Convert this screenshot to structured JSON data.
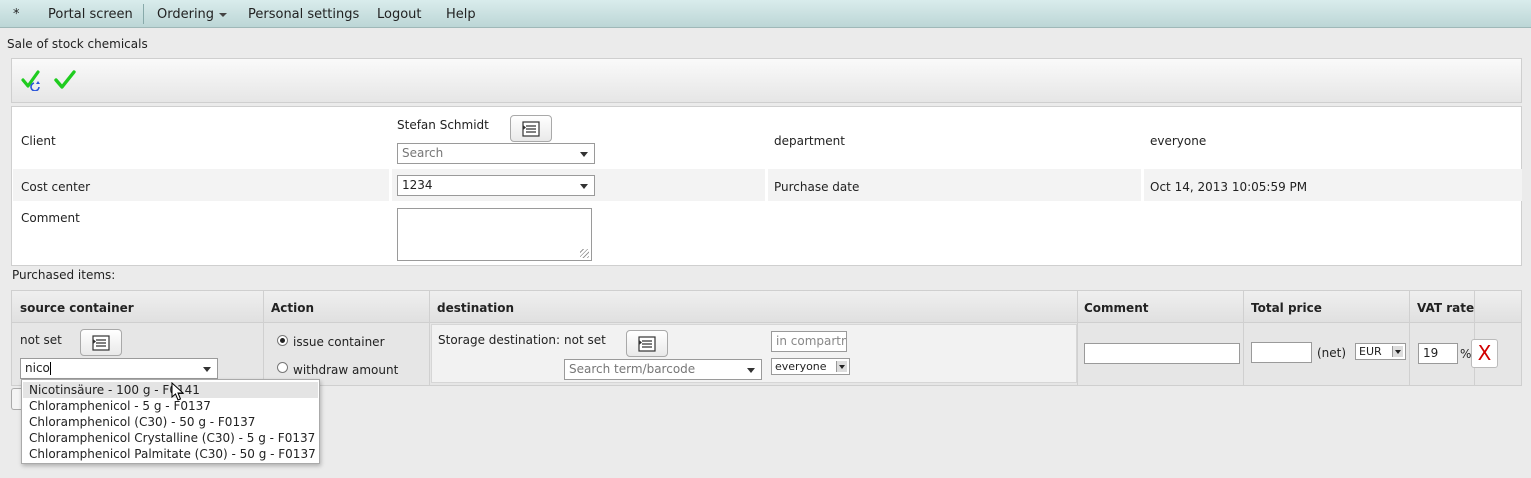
{
  "menu": {
    "star": "*",
    "portal": "Portal screen",
    "ordering": "Ordering",
    "personal_settings": "Personal settings",
    "logout": "Logout",
    "help": "Help"
  },
  "page_title": "Sale of stock chemicals",
  "toolbar": {
    "icons": [
      "check-refresh-icon",
      "check-icon"
    ],
    "accent": "#1fcc1f"
  },
  "form": {
    "client_label": "Client",
    "client_name": "Stefan Schmidt",
    "client_search_placeholder": "Search",
    "department_label": "department",
    "department_value": "everyone",
    "cost_center_label": "Cost center",
    "cost_center_value": "1234",
    "purchase_date_label": "Purchase date",
    "purchase_date_value": "Oct 14, 2013 10:05:59 PM",
    "comment_label": "Comment",
    "comment_value": ""
  },
  "items": {
    "section_label": "Purchased items:",
    "columns": [
      "source container",
      "Action",
      "destination",
      "Comment",
      "Total price",
      "VAT rate"
    ],
    "row": {
      "source_status": "not set",
      "source_input": "nico",
      "action_issue": "issue container",
      "action_withdraw": "withdraw amount",
      "action_selected": "issue container",
      "storage_label": "Storage destination:",
      "storage_status": "not set",
      "destination_search_placeholder": "Search term/barcode",
      "compartment_placeholder": "in compartment",
      "group_value": "everyone",
      "comment_value": "",
      "price_value": "",
      "net_label": "(net)",
      "currency": "EUR",
      "vat_value": "19",
      "vat_unit": "%",
      "remove_label": "X"
    }
  },
  "suggestions": [
    "Nicotinsäure - 100 g - F0141",
    "Chloramphenicol - 5 g - F0137",
    "Chloramphenicol (C30) - 50 g - F0137",
    "Chloramphenicol Crystalline (C30) - 5 g - F0137",
    "Chloramphenicol Palmitate (C30) - 50 g - F0137"
  ],
  "selected_suggestion": "Nicotinsäure - 100 g - F0141"
}
